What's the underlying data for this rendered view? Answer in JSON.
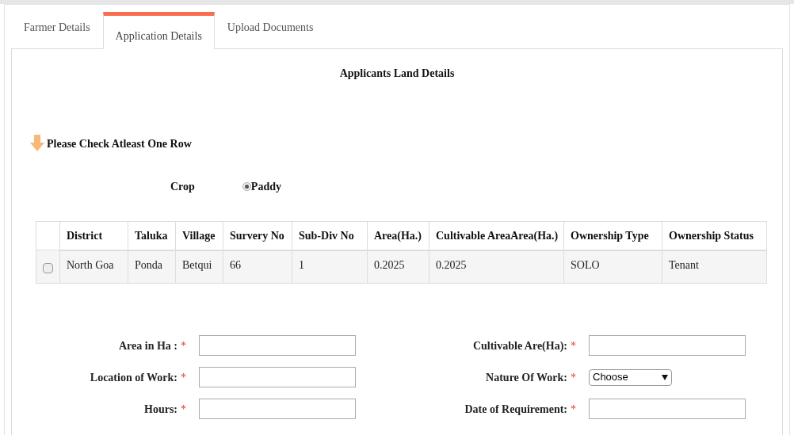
{
  "tabs": [
    {
      "label": "Farmer Details",
      "selected": false
    },
    {
      "label": "Application Details",
      "selected": true
    },
    {
      "label": "Upload Documents",
      "selected": false
    }
  ],
  "section_title": "Applicants Land Details",
  "notice": "Please Check Atleast One Row",
  "crop": {
    "label": "Crop",
    "options": [
      {
        "label": "Paddy",
        "selected": true
      }
    ]
  },
  "table": {
    "columns": [
      "District",
      "Taluka",
      "Village",
      "Survery No",
      "Sub-Div No",
      "Area(Ha.)",
      "Cultivable AreaArea(Ha.)",
      "Ownership Type",
      "Ownership Status"
    ],
    "rows": [
      {
        "checked": false,
        "cells": [
          "North Goa",
          "Ponda",
          "Betqui",
          "66",
          "1",
          "0.2025",
          "0.2025",
          "SOLO",
          "Tenant"
        ]
      }
    ]
  },
  "form": {
    "left": [
      {
        "label": "Area in Ha :",
        "required_mark": "*",
        "kind": "text"
      },
      {
        "label": "Location of Work:",
        "required_mark": "*",
        "kind": "text"
      },
      {
        "label": "Hours:",
        "required_mark": "*",
        "kind": "text"
      }
    ],
    "right": [
      {
        "label": "Cultivable Are(Ha):",
        "required_mark": "*",
        "kind": "text"
      },
      {
        "label": "Nature Of Work:",
        "required_mark": "*",
        "kind": "select",
        "value": "Choose"
      },
      {
        "label": "Date of Requirement:",
        "required_mark": "*",
        "kind": "text"
      }
    ]
  }
}
